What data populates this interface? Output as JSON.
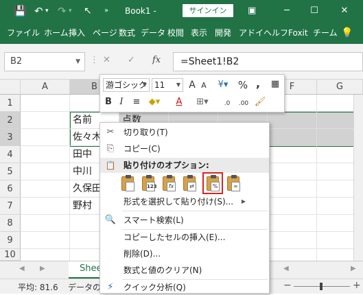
{
  "titlebar": {
    "filename": "Book1  -",
    "signin": "サインイン",
    "colors": {
      "bg": "#217346",
      "fg": "#ffffff"
    }
  },
  "ribbon_tabs": [
    "ファイル",
    "ホーム",
    "挿入",
    "ページ",
    "数式",
    "データ",
    "校閲",
    "表示",
    "開発",
    "アドイ",
    "ヘルフ",
    "Foxit",
    "チーム"
  ],
  "namebox": "B2",
  "formula": "=Sheet1!B2",
  "fx": "fx",
  "columns": [
    "A",
    "B",
    "F",
    "G"
  ],
  "rows": [
    "1",
    "2",
    "3",
    "4",
    "5",
    "6",
    "7",
    "8",
    "9",
    "10"
  ],
  "cells": {
    "b2": "名前",
    "c2": "点数",
    "b3": "佐々木",
    "b4": "田中",
    "b5": "中川",
    "b6": "久保田",
    "b7": "野村"
  },
  "minitoolbar": {
    "font": "游ゴシック",
    "size": "11",
    "grow": "A",
    "shrink": "A",
    "percent": "%",
    "comma": ",",
    "bold": "B",
    "italic": "I",
    "align": "≡",
    "fontcolor": "A",
    "inc_decimal": ".0",
    "dec_decimal": ".00"
  },
  "context_menu": {
    "cut": "切り取り(T)",
    "copy": "コピー(C)",
    "paste_options": "貼り付けのオプション:",
    "paste_special": "形式を選択して貼り付け(S)...",
    "smart_lookup": "スマート検索(L)",
    "insert_copied": "コピーしたセルの挿入(E)...",
    "delete": "削除(D)...",
    "clear": "数式と値のクリア(N)",
    "quick_analysis": "クイック分析(Q)",
    "paste_icons": [
      "",
      "123",
      "fx",
      "",
      "%",
      ""
    ],
    "highlight_color": "#e02020"
  },
  "sheet_tab": "Shee",
  "status": {
    "average": "平均: 81.6",
    "count_label": "データの個"
  }
}
